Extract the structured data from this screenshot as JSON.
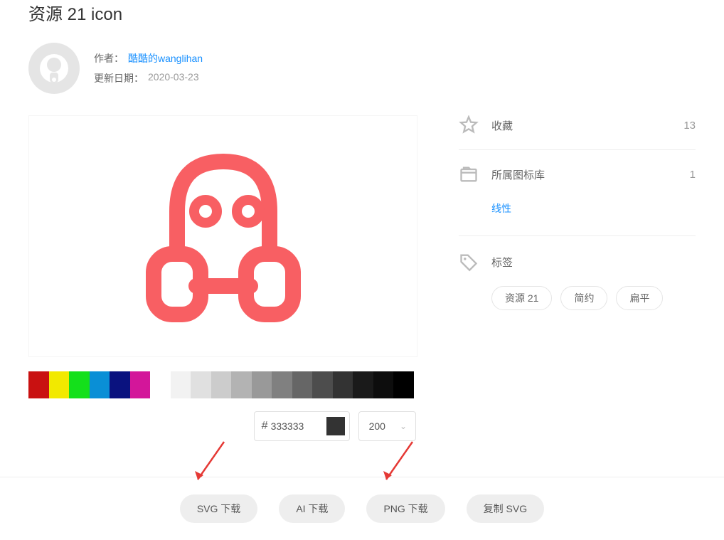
{
  "title": "资源 21  icon",
  "author": {
    "label": "作者：",
    "name": "酷酷的wanglihan"
  },
  "date": {
    "label": "更新日期：",
    "value": "2020-03-23"
  },
  "palette": [
    "#c91111",
    "#f2e900",
    "#14e01b",
    "#0a8fd6",
    "#0a127f",
    "#d3169a",
    "#ffffff",
    "#f2f2f2",
    "#e0e0e0",
    "#cccccc",
    "#b3b3b3",
    "#999999",
    "#808080",
    "#666666",
    "#4d4d4d",
    "#333333",
    "#1a1a1a",
    "#0d0d0d",
    "#000000"
  ],
  "color_input": "333333",
  "size_value": "200",
  "stats": {
    "favorites": {
      "label": "收藏",
      "value": "13"
    },
    "libraries": {
      "label": "所属图标库",
      "value": "1",
      "sublink": "线性"
    }
  },
  "tags_section": {
    "label": "标签"
  },
  "tags": [
    "资源 21",
    "简约",
    "扁平"
  ],
  "downloads": {
    "svg": "SVG 下载",
    "ai": "AI 下载",
    "png": "PNG 下载",
    "copy": "复制 SVG"
  }
}
